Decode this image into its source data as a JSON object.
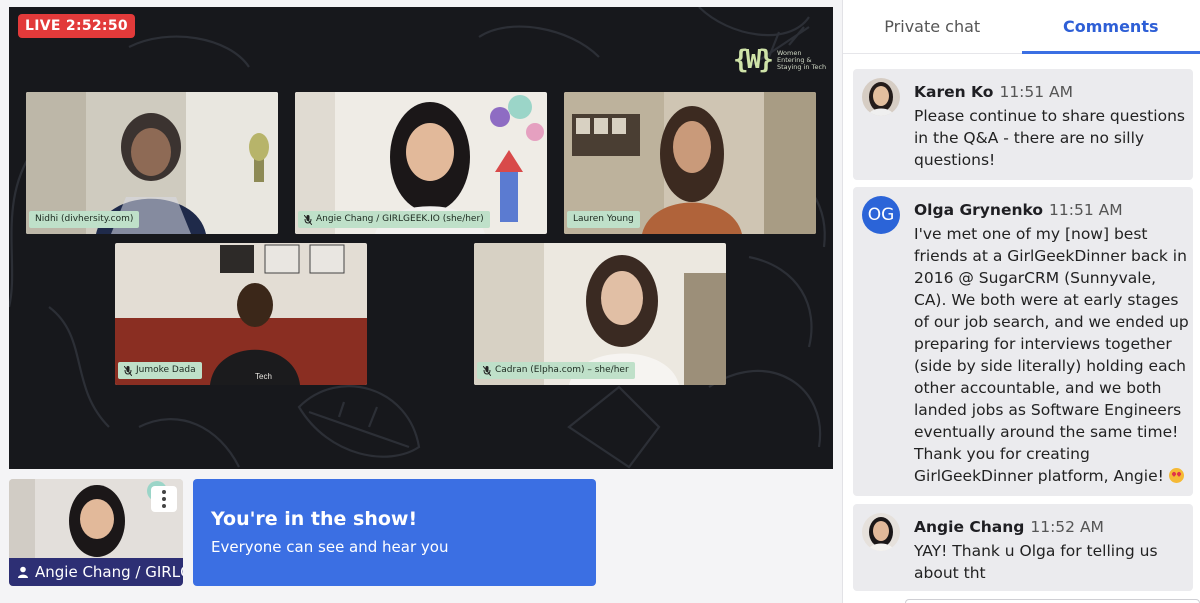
{
  "live": {
    "label": "LIVE 2:52:50"
  },
  "brand": {
    "logo_text": "{W}",
    "tagline": "Women Entering & Staying in Tech"
  },
  "participants": [
    {
      "name": "Nidhi (divhersity.com)",
      "muted": false
    },
    {
      "name": "Angie Chang / GIRLGEEK.IO (she/her)",
      "muted": true
    },
    {
      "name": "Lauren Young",
      "muted": false
    },
    {
      "name": "Jumoke Dada",
      "muted": true
    },
    {
      "name": "Cadran (Elpha.com) – she/her",
      "muted": true
    }
  ],
  "self_view": {
    "name": "Angie Chang / GIRLGEEK.IO (she/her)"
  },
  "banner": {
    "title": "You're in the show!",
    "subtitle": "Everyone can see and hear you"
  },
  "panel": {
    "tabs": [
      {
        "label": "Private chat",
        "active": false
      },
      {
        "label": "Comments",
        "active": true
      }
    ],
    "comments": [
      {
        "author": "Karen Ko",
        "time": "11:51 AM",
        "text": "Please continue to share questions in the Q&A - there are no silly questions!",
        "avatar": "photo"
      },
      {
        "author": "Olga Grynenko",
        "time": "11:51 AM",
        "text": "I've met one of my [now] best friends at a GirlGeekDinner back in 2016 @ SugarCRM (Sunnyvale, CA). We both were at early stages of our job search, and we ended up preparing for interviews together (side by side literally) holding each other accountable, and we both landed jobs as Software Engineers eventually around the same time! Thank you for creating GirlGeekDinner platform, Angie!",
        "avatar": "OG"
      },
      {
        "author": "Angie Chang",
        "time": "11:52 AM",
        "text": "YAY! Thank u Olga for telling us about tht",
        "avatar": "photo"
      }
    ]
  }
}
